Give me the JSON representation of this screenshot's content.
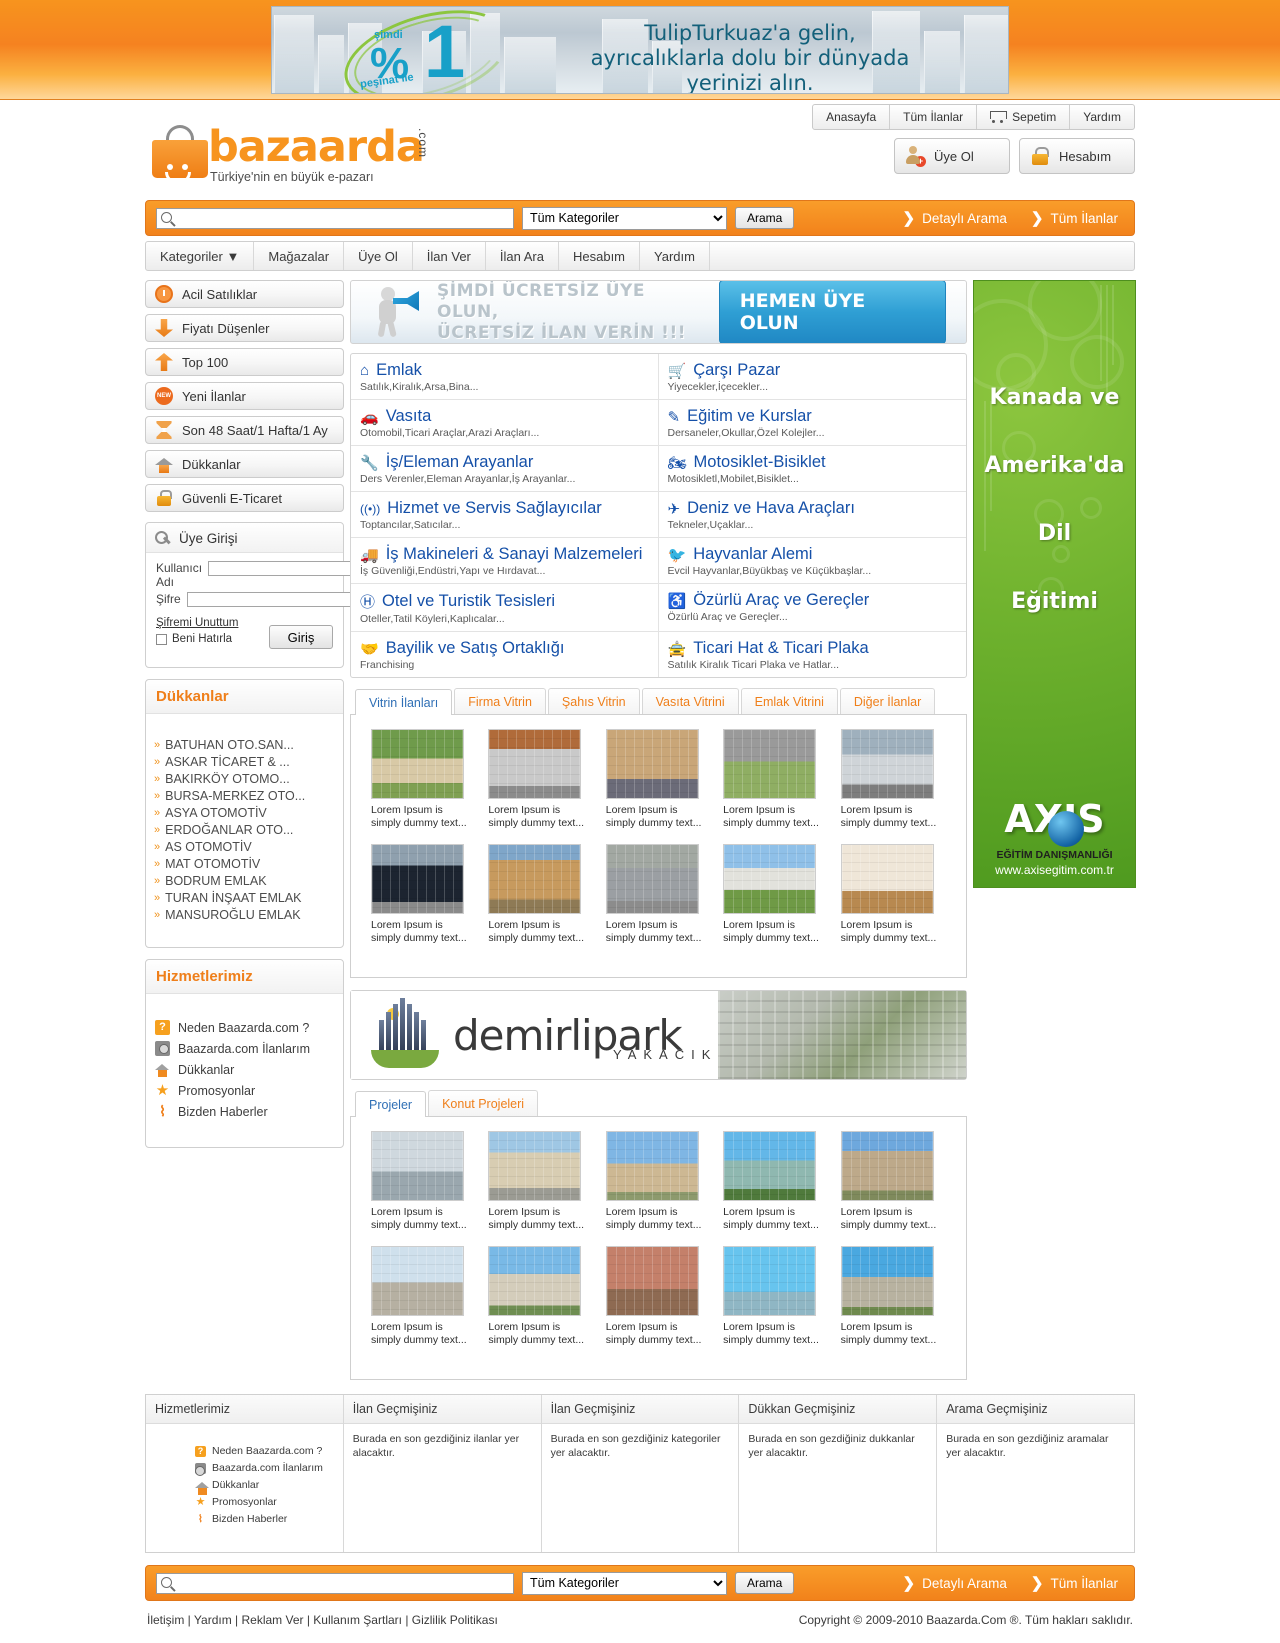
{
  "top_ad": {
    "percent": "1",
    "percent_symbol": "%",
    "simdi": "şimdi",
    "pesinat": "peşinat ile",
    "line1": "TulipTurkuaz'a gelin,",
    "line2": "ayrıcalıklarla dolu bir dünyada",
    "line3": "yerinizi alın."
  },
  "header": {
    "logo_word": "bazaarda",
    "logo_dotcom": ".com",
    "logo_tagline": "Türkiye'nin en büyük e-pazarı",
    "topnav": [
      {
        "label": "Anasayfa",
        "icon": ""
      },
      {
        "label": "Tüm İlanlar",
        "icon": ""
      },
      {
        "label": "Sepetim",
        "icon": "cart-icon"
      },
      {
        "label": "Yardım",
        "icon": ""
      }
    ],
    "auth": [
      {
        "label": "Üye Ol",
        "icon": "user-add-icon"
      },
      {
        "label": "Hesabım",
        "icon": "lock-icon"
      }
    ]
  },
  "search": {
    "placeholder": "",
    "value": "",
    "category_selected": "Tüm Kategoriler",
    "button_label": "Arama",
    "links": [
      {
        "label": "Detaylı Arama"
      },
      {
        "label": "Tüm İlanlar"
      }
    ]
  },
  "mainnav": [
    {
      "label": "Kategoriler ▼"
    },
    {
      "label": "Mağazalar"
    },
    {
      "label": "Üye Ol"
    },
    {
      "label": "İlan Ver"
    },
    {
      "label": "İlan Ara"
    },
    {
      "label": "Hesabım"
    },
    {
      "label": "Yardım"
    }
  ],
  "sidebar": {
    "buttons": [
      {
        "label": "Acil Satılıklar",
        "icon": "clock-icon"
      },
      {
        "label": "Fiyatı Düşenler",
        "icon": "arrow-down-icon"
      },
      {
        "label": "Top 100",
        "icon": "arrow-up-icon"
      },
      {
        "label": "Yeni İlanlar",
        "icon": "new-badge-icon"
      },
      {
        "label": "Son 48 Saat/1 Hafta/1 Ay",
        "icon": "hourglass-icon"
      },
      {
        "label": "Dükkanlar",
        "icon": "home-icon"
      },
      {
        "label": "Güvenli E-Ticaret",
        "icon": "lock-icon"
      }
    ],
    "login": {
      "title": "Üye Girişi",
      "username_label": "Kullanıcı Adı",
      "password_label": "Şifre",
      "username_value": "",
      "password_value": "",
      "forgot_label": "Şifremi Unuttum",
      "remember_label": "Beni Hatırla",
      "submit_label": "Giriş"
    },
    "shops": {
      "title": "Dükkanlar",
      "items": [
        "BATUHAN OTO.SAN...",
        "ASKAR TİCARET & ...",
        "BAKIRKÖY OTOMO...",
        "BURSA-MERKEZ OTO...",
        "ASYA OTOMOTİV",
        "ERDOĞANLAR OTO...",
        "AS OTOMOTİV",
        "MAT OTOMOTİV",
        "BODRUM EMLAK",
        "TURAN İNŞAAT EMLAK",
        "MANSUROĞLU EMLAK"
      ]
    },
    "services": {
      "title": "Hizmetlerimiz",
      "items": [
        {
          "label": "Neden Baazarda.com ?",
          "icon": "question-icon"
        },
        {
          "label": "Baazarda.com İlanlarım",
          "icon": "camera-icon"
        },
        {
          "label": "Dükkanlar",
          "icon": "home-icon"
        },
        {
          "label": "Promosyonlar",
          "icon": "star-icon"
        },
        {
          "label": "Bizden Haberler",
          "icon": "rss-icon"
        }
      ]
    }
  },
  "promo": {
    "line1": "ŞİMDİ ÜCRETSİZ ÜYE OLUN,",
    "line2": "ÜCRETSİZ İLAN VERİN !!!",
    "button": "HEMEN ÜYE OLUN"
  },
  "categories": [
    [
      {
        "title": "Emlak",
        "sub": "Satılık,Kiralık,Arsa,Bina...",
        "icon": "home-icon",
        "glyph": "⌂"
      },
      {
        "title": "Çarşı Pazar",
        "sub": "Yiyecekler,İçecekler...",
        "icon": "cart-icon",
        "glyph": "🛒"
      }
    ],
    [
      {
        "title": "Vasıta",
        "sub": "Otomobil,Ticari Araçlar,Arazi Araçları...",
        "icon": "car-icon",
        "glyph": "🚗"
      },
      {
        "title": "Eğitim ve Kurslar",
        "sub": "Dersaneler,Okullar,Özel Kolejler...",
        "icon": "pencil-icon",
        "glyph": "✎"
      }
    ],
    [
      {
        "title": "İş/Eleman Arayanlar",
        "sub": "Ders Verenler,Eleman Arayanlar,İş Arayanlar...",
        "icon": "wrench-icon",
        "glyph": "🔧"
      },
      {
        "title": "Motosiklet-Bisiklet",
        "sub": "Motosikletl,Mobilet,Bisiklet...",
        "icon": "motorcycle-icon",
        "glyph": "🏍"
      }
    ],
    [
      {
        "title": "Hizmet ve Servis Sağlayıcılar",
        "sub": "Toptancılar,Satıcılar...",
        "icon": "signal-icon",
        "glyph": "((•))"
      },
      {
        "title": "Deniz ve Hava Araçları",
        "sub": "Tekneler,Uçaklar...",
        "icon": "plane-icon",
        "glyph": "✈"
      }
    ],
    [
      {
        "title": "İş Makineleri & Sanayi Malzemeleri",
        "sub": "İş Güvenliği,Endüstri,Yapı ve Hırdavat...",
        "icon": "truck-icon",
        "glyph": "🚚"
      },
      {
        "title": "Hayvanlar Alemi",
        "sub": "Evcil Hayvanlar,Büyükbaş ve Küçükbaşlar...",
        "icon": "bird-icon",
        "glyph": "🐦"
      }
    ],
    [
      {
        "title": "Otel ve Turistik Tesisleri",
        "sub": "Oteller,Tatil Köyleri,Kaplıcalar...",
        "icon": "hotel-icon",
        "glyph": "Ⓗ"
      },
      {
        "title": "Özürlü Araç ve Gereçler",
        "sub": "Özürlü Araç ve Gereçler...",
        "icon": "wheelchair-icon",
        "glyph": "♿"
      }
    ],
    [
      {
        "title": "Bayilik ve Satış Ortaklığı",
        "sub": "Franchising",
        "icon": "handshake-icon",
        "glyph": "🤝"
      },
      {
        "title": "Ticari Hat & Ticari Plaka",
        "sub": "Satılık Kiralık Ticari Plaka ve Hatlar...",
        "icon": "taxi-icon",
        "glyph": "🚖"
      }
    ]
  ],
  "showcase": {
    "tabs": [
      {
        "label": "Vitrin İlanları",
        "active": true
      },
      {
        "label": "Firma Vitrin",
        "active": false
      },
      {
        "label": "Şahıs Vitrin",
        "active": false
      },
      {
        "label": "Vasıta Vitrini",
        "active": false
      },
      {
        "label": "Emlak Vitrini",
        "active": false
      },
      {
        "label": "Diğer İlanlar",
        "active": false
      }
    ],
    "items": [
      {
        "caption": "Lorem Ipsum is simply dummy text...",
        "photo": "house1"
      },
      {
        "caption": "Lorem Ipsum is simply dummy text...",
        "photo": "van"
      },
      {
        "caption": "Lorem Ipsum is simply dummy text...",
        "photo": "apt"
      },
      {
        "caption": "Lorem Ipsum is simply dummy text...",
        "photo": "yard"
      },
      {
        "caption": "Lorem Ipsum is simply dummy text...",
        "photo": "car1"
      },
      {
        "caption": "Lorem Ipsum is simply dummy text...",
        "photo": "car2"
      },
      {
        "caption": "Lorem Ipsum is simply dummy text...",
        "photo": "villa"
      },
      {
        "caption": "Lorem Ipsum is simply dummy text...",
        "photo": "suv"
      },
      {
        "caption": "Lorem Ipsum is simply dummy text...",
        "photo": "house2"
      },
      {
        "caption": "Lorem Ipsum is simply dummy text...",
        "photo": "room"
      }
    ]
  },
  "demirlipark": {
    "name": "demirlipark",
    "sub": "YAKACIK",
    "tabs": [
      {
        "label": "Projeler",
        "active": true
      },
      {
        "label": "Konut Projeleri",
        "active": false
      }
    ],
    "items": [
      {
        "caption": "Lorem Ipsum is simply dummy text...",
        "photo": "tower1"
      },
      {
        "caption": "Lorem Ipsum is simply dummy text...",
        "photo": "tower2"
      },
      {
        "caption": "Lorem Ipsum is simply dummy text...",
        "photo": "tower3"
      },
      {
        "caption": "Lorem Ipsum is simply dummy text...",
        "photo": "tower4"
      },
      {
        "caption": "Lorem Ipsum is simply dummy text...",
        "photo": "tower5"
      },
      {
        "caption": "Lorem Ipsum is simply dummy text...",
        "photo": "tower6"
      },
      {
        "caption": "Lorem Ipsum is simply dummy text...",
        "photo": "tower7"
      },
      {
        "caption": "Lorem Ipsum is simply dummy text...",
        "photo": "tower8"
      },
      {
        "caption": "Lorem Ipsum is simply dummy text...",
        "photo": "tower9"
      },
      {
        "caption": "Lorem Ipsum is simply dummy text...",
        "photo": "tower10"
      }
    ]
  },
  "green_ad": {
    "line1": "Kanada ve",
    "line2": "Amerika'da",
    "line3": "Dil",
    "line4": "Eğitimi",
    "brand": "AXIS",
    "brand_sub": "EĞİTİM DANIŞMANLIĞI",
    "url": "www.axisegitim.com.tr"
  },
  "footer_table": {
    "columns": [
      {
        "header": "Hizmetlerimiz",
        "type": "links",
        "items": [
          {
            "label": "Neden Baazarda.com ?",
            "icon": "question-icon"
          },
          {
            "label": "Baazarda.com İlanlarım",
            "icon": "camera-icon"
          },
          {
            "label": "Dükkanlar",
            "icon": "home-icon"
          },
          {
            "label": "Promosyonlar",
            "icon": "star-icon"
          },
          {
            "label": "Bizden Haberler",
            "icon": "rss-icon"
          }
        ]
      },
      {
        "header": "İlan Geçmişiniz",
        "type": "text",
        "text": "Burada en son gezdiğiniz ilanlar yer alacaktır."
      },
      {
        "header": "İlan Geçmişiniz",
        "type": "text",
        "text": "Burada en son gezdiğiniz kategoriler yer alacaktır."
      },
      {
        "header": "Dükkan Geçmişiniz",
        "type": "text",
        "text": "Burada en son gezdiğiniz dukkanlar yer alacaktır."
      },
      {
        "header": "Arama Geçmişiniz",
        "type": "text",
        "text": "Burada en son gezdiğiniz aramalar yer alacaktır."
      }
    ]
  },
  "footer": {
    "links": "İletişim | Yardım | Reklam Ver | Kullanım Şartları | Gizlilik Politikası",
    "copyright": "Copyright © 2009-2010 Baazarda.Com ®. Tüm hakları saklıdır."
  }
}
